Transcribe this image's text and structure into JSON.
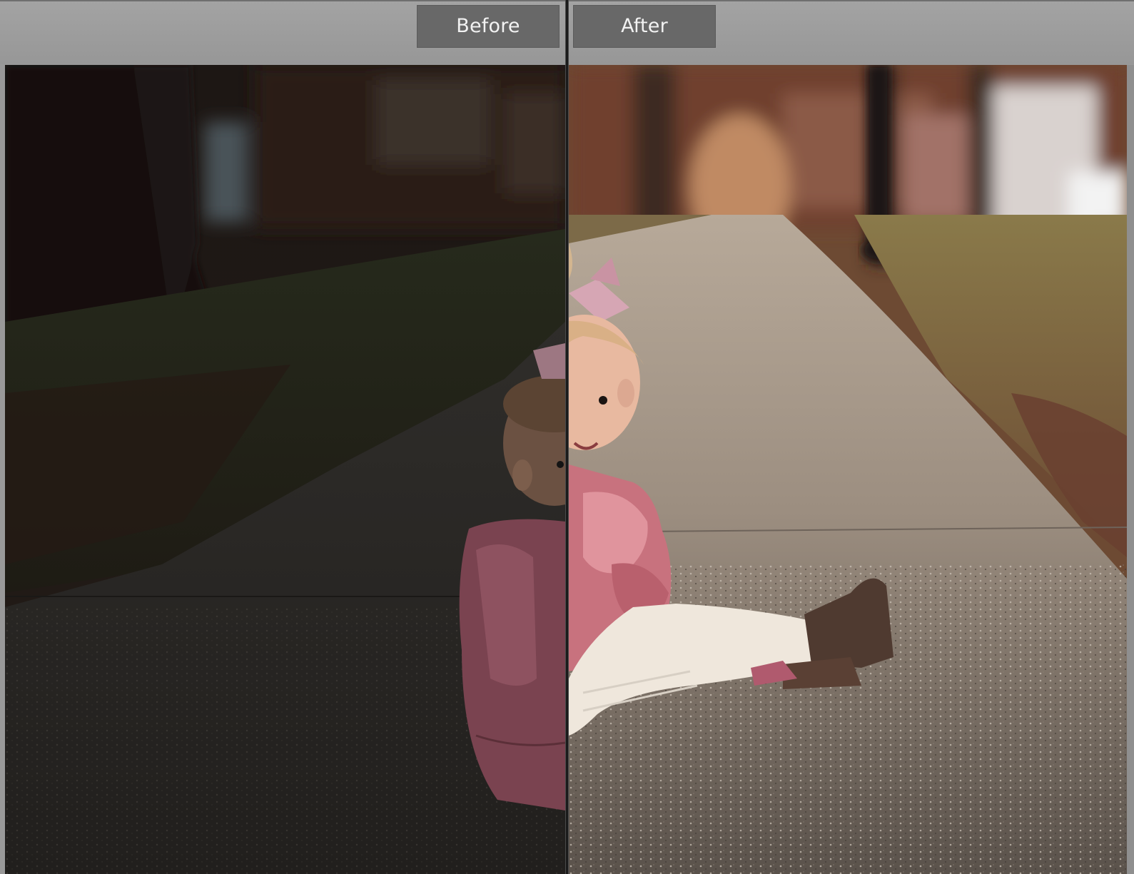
{
  "compare_view": {
    "before_label": "Before",
    "after_label": "After"
  },
  "icons": {
    "before-photo": "photo-before-edit",
    "after-photo": "photo-after-edit"
  },
  "colors": {
    "toolbar_bg": "#999999",
    "label_bg": "#686868",
    "label_text": "#f2f2f2",
    "divider": "#1b1b1b"
  }
}
